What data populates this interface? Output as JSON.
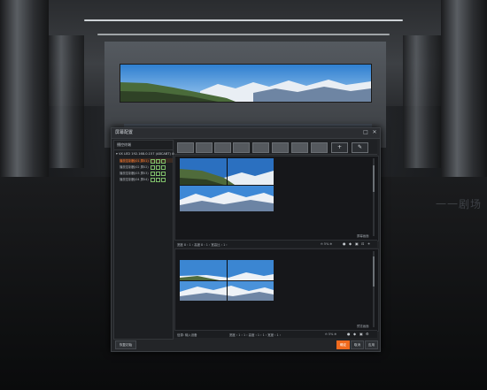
{
  "dialog": {
    "title": "屏幕配置",
    "min_label": "□",
    "close_label": "✕"
  },
  "sidebar": {
    "header": "播控终端",
    "root": "▾ VX LED 192.168.0.157 (ABCABT) ⊘",
    "devices": [
      {
        "label": "播放控制器(01 屏01)"
      },
      {
        "label": "播放控制器(02 屏02)"
      },
      {
        "label": "播放控制器(03 屏03)"
      },
      {
        "label": "播放控制器(04 屏04)"
      }
    ]
  },
  "layouts": {
    "add_label": "+",
    "edit_label": "✎"
  },
  "top_panel": {
    "label": "屏幕画面",
    "controls": {
      "left": "宽度 8 ‹ 1 › 高度 8 ‹ 1 › 宽高比 ‹ 1 ›",
      "zoom": "⊖ 5% ⊕"
    }
  },
  "bottom_panel": {
    "label": "预览画面",
    "controls": {
      "source": "信源: 输入设备",
      "left": "宽度 ‹ 1 › 1 › 高度 ‹ 1 › 1 › 宽度 ‹ 1 ›",
      "zoom": "⊖ 5% ⊕"
    }
  },
  "footer": {
    "left_button": "恢复初始",
    "ok": "确定",
    "cancel": "取消",
    "apply": "应用"
  },
  "background": {
    "ghost_text": "一一剧场"
  },
  "colors": {
    "accent": "#f06a1e",
    "selected_text": "#ff7a2f",
    "status_icon": "#7fbf6a"
  }
}
